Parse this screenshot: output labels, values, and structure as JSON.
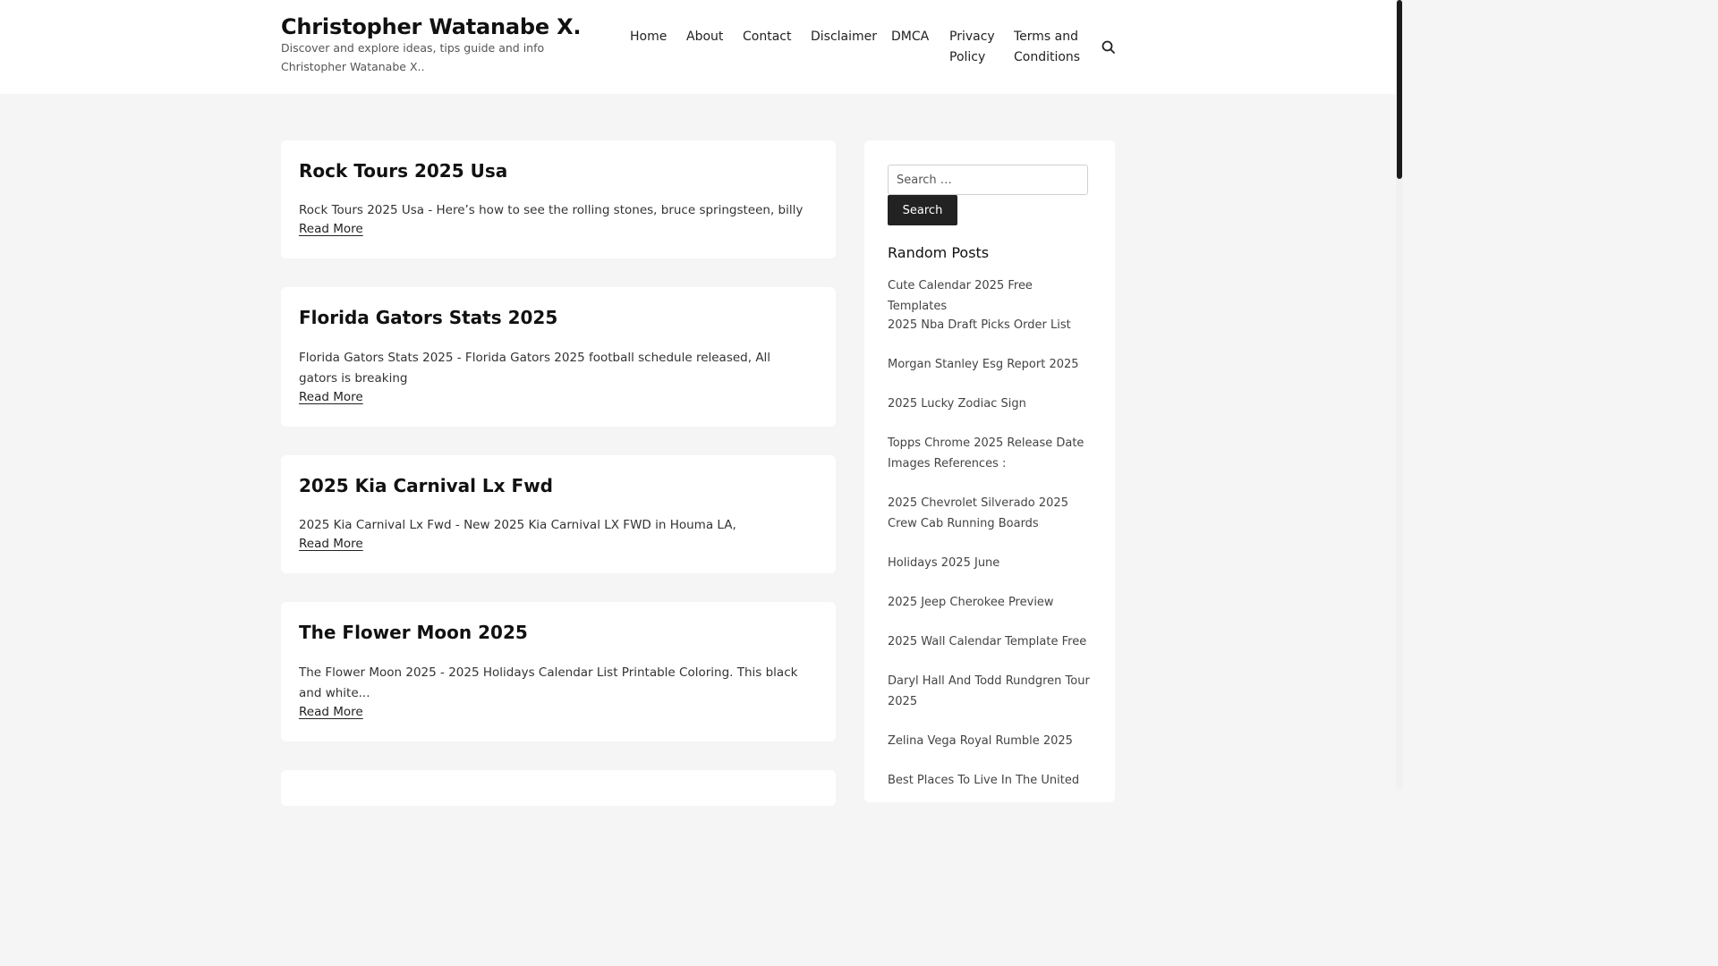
{
  "header": {
    "title": "Christopher Watanabe X.",
    "description": "Discover and explore ideas, tips guide and info Christopher Watanabe X.."
  },
  "nav": {
    "items": [
      {
        "label": "Home"
      },
      {
        "label": "About"
      },
      {
        "label": "Contact"
      },
      {
        "label": "Disclaimer"
      },
      {
        "label": "DMCA"
      },
      {
        "label": "Privacy Policy"
      },
      {
        "label": "Terms and Conditions"
      }
    ],
    "search_icon": "search-icon"
  },
  "posts": [
    {
      "title": "Rock Tours 2025 Usa",
      "excerpt": "Rock Tours 2025 Usa - Here’s how to see the rolling stones, bruce springsteen, billy",
      "read_more": "Read More"
    },
    {
      "title": "Florida Gators Stats 2025",
      "excerpt": "Florida Gators Stats 2025 - Florida Gators 2025 football schedule released, All gators is breaking",
      "read_more": "Read More"
    },
    {
      "title": "2025 Kia Carnival Lx Fwd",
      "excerpt": "2025 Kia Carnival Lx Fwd - New 2025 Kia Carnival LX FWD in Houma LA,",
      "read_more": "Read More"
    },
    {
      "title": "The Flower Moon 2025",
      "excerpt": "The Flower Moon 2025 - 2025 Holidays Calendar List Printable Coloring. This black and white...",
      "read_more": "Read More"
    }
  ],
  "sidebar": {
    "search_placeholder": "Search …",
    "search_button": "Search",
    "random_posts_title": "Random Posts",
    "random_posts": [
      "Cute Calendar 2025 Free Templates",
      "2025 Nba Draft Picks Order List",
      "Morgan Stanley Esg Report 2025",
      "2025 Lucky Zodiac Sign",
      "Topps Chrome 2025 Release Date Images References :",
      "2025 Chevrolet Silverado 2025 Crew Cab Running Boards",
      "Holidays 2025 June",
      "2025 Jeep Cherokee Preview",
      "2025 Wall Calendar Template Free",
      "Daryl Hall And Todd Rundgren Tour 2025",
      "Zelina Vega Royal Rumble 2025",
      "Best Places To Live In The United"
    ]
  },
  "colors": {
    "background": "#f5f5f5",
    "card": "#ffffff",
    "button": "#222222"
  }
}
